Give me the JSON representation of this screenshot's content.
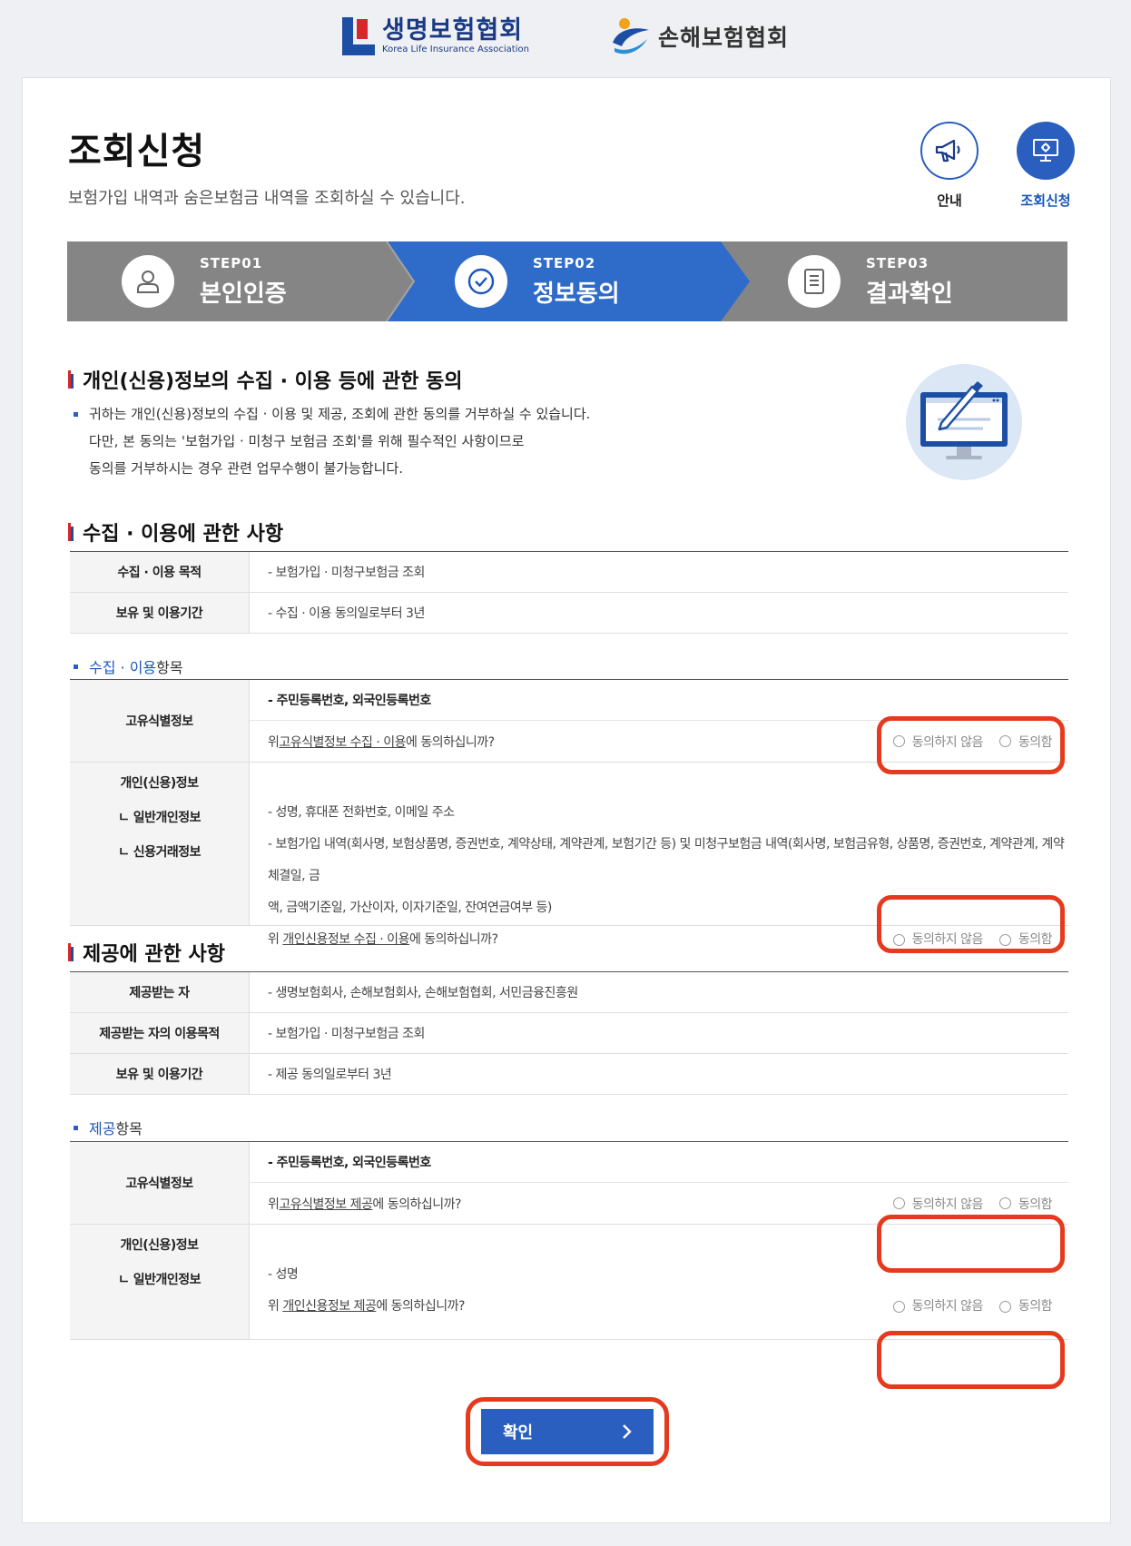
{
  "logos": {
    "life_ko": "생명보험협회",
    "life_en": "Korea Life Insurance Association",
    "nonlife_ko": "손해보험협회"
  },
  "header": {
    "title": "조회신청",
    "subtitle": "보험가입 내역과 숨은보험금 내역을 조회하실 수 있습니다.",
    "icons": [
      {
        "label": "안내",
        "icon": "megaphone-icon"
      },
      {
        "label": "조회신청",
        "icon": "monitor-icon"
      }
    ]
  },
  "steps": [
    {
      "num": "STEP01",
      "name": "본인인증",
      "icon": "person-icon"
    },
    {
      "num": "STEP02",
      "name": "정보동의",
      "icon": "check-circle-icon"
    },
    {
      "num": "STEP03",
      "name": "결과확인",
      "icon": "document-icon"
    }
  ],
  "intro": {
    "heading": "개인(신용)정보의 수집 · 이용 등에 관한 동의",
    "lines": [
      "귀하는 개인(신용)정보의 수집 · 이용 및 제공, 조회에 관한 동의를 거부하실 수 있습니다.",
      "다만, 본 동의는 '보험가입 · 미청구 보험금 조회'를 위해 필수적인 사항이므로",
      "동의를 거부하시는 경우 관련 업무수행이 불가능합니다."
    ]
  },
  "collect": {
    "heading": "수집 · 이용에 관한 사항",
    "rows": [
      {
        "th": "수집 · 이용 목적",
        "td": "- 보험가입 · 미청구보험금 조회"
      },
      {
        "th": "보유 및 이용기간",
        "td": "- 수집 · 이용 동의일로부터 3년"
      }
    ],
    "items_head_blue": "수집 · 이용",
    "items_head_rest": " 항목",
    "unique": {
      "th": "고유식별정보",
      "item": "- 주민등록번호, 외국인등록번호",
      "q_pre": "위 ",
      "q_u": "고유식별정보 수집 · 이용",
      "q_post": "에 동의하십니까?"
    },
    "personal": {
      "th1": "개인(신용)정보",
      "th2": "ㄴ 일반개인정보",
      "th3": "ㄴ 신용거래정보",
      "item1": "- 성명, 휴대폰 전화번호, 이메일 주소",
      "item2a": "- 보험가입 내역(회사명, 보험상품명, 증권번호, 계약상태, 계약관계, 보험기간 등) 및 미청구보험금 내역(회사명, 보험금유형, 상품명, 증권번호, 계약관계, 계약체결일, 금",
      "item2b": "액, 금액기준일, 가산이자, 이자기준일, 잔여연금여부 등)",
      "q_pre": "위 ",
      "q_u": "개인신용정보 수집 · 이용",
      "q_post": "에 동의하십니까?"
    }
  },
  "provide": {
    "heading": "제공에 관한 사항",
    "rows": [
      {
        "th": "제공받는 자",
        "td": "- 생명보험회사, 손해보험회사, 손해보험협회, 서민금융진흥원"
      },
      {
        "th": "제공받는 자의 이용목적",
        "td": "- 보험가입 · 미청구보험금 조회"
      },
      {
        "th": "보유 및 이용기간",
        "td": "- 제공 동의일로부터 3년"
      }
    ],
    "items_head_blue": "제공",
    "items_head_rest": " 항목",
    "unique": {
      "th": "고유식별정보",
      "item": "- 주민등록번호, 외국인등록번호",
      "q_pre": "위 ",
      "q_u": "고유식별정보 제공",
      "q_post": "에 동의하십니까?"
    },
    "personal": {
      "th1": "개인(신용)정보",
      "th2": "ㄴ 일반개인정보",
      "item1": "- 성명",
      "q_pre": "위 ",
      "q_u": "개인신용정보 제공",
      "q_post": "에 동의하십니까?"
    }
  },
  "radio": {
    "disagree": "동의하지 않음",
    "agree": "동의함"
  },
  "confirm": {
    "label": "확인",
    "arrow": "›"
  },
  "colors": {
    "accent": "#2a5fbf",
    "highlight": "#e53a1d",
    "step_inactive": "#858585"
  }
}
